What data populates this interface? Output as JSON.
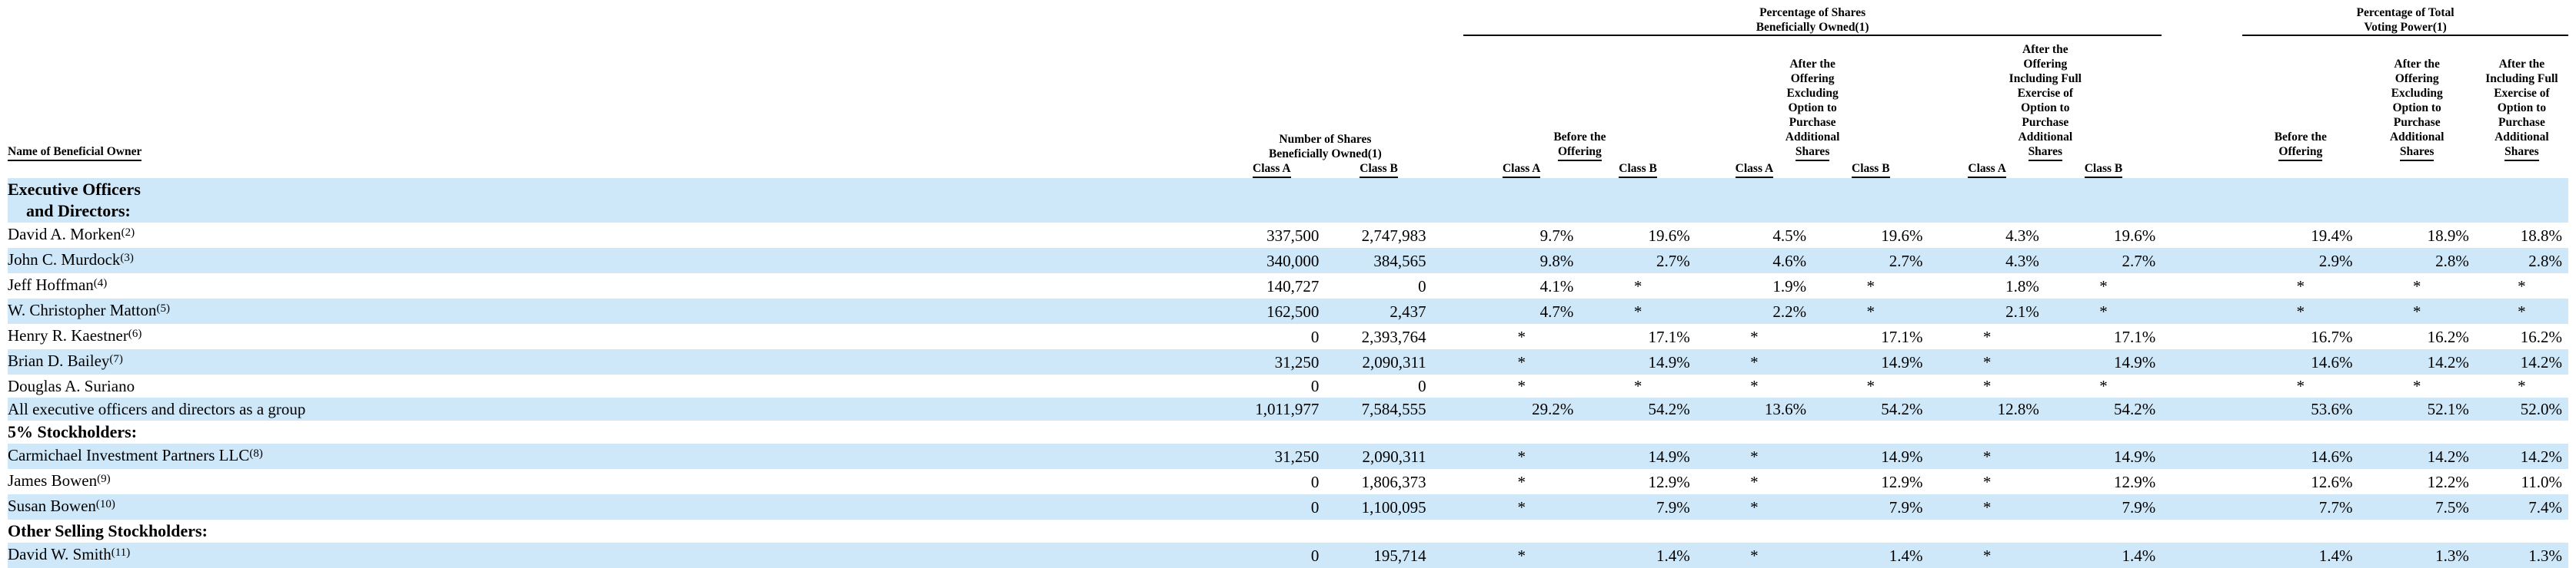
{
  "header": {
    "owner_col": "Name of Beneficial Owner",
    "shares_group": [
      "Number of Shares",
      "Beneficially Owned(1)"
    ],
    "pct_shares_group": [
      "Percentage of Shares",
      "Beneficially Owned(1)"
    ],
    "pct_voting_group": [
      "Percentage of Total",
      "Voting Power(1)"
    ],
    "before_offering": [
      "Before the",
      "Offering"
    ],
    "after_excl": [
      "After the",
      "Offering",
      "Excluding",
      "Option to",
      "Purchase",
      "Additional",
      "Shares"
    ],
    "after_incl": [
      "After the",
      "Offering",
      "Including Full",
      "Exercise of",
      "Option to",
      "Purchase",
      "Additional",
      "Shares"
    ],
    "class_a": "Class A",
    "class_b": "Class B"
  },
  "rows": [
    {
      "type": "section",
      "label": "Executive Officers",
      "label2": "and Directors:",
      "shaded": true
    },
    {
      "type": "data",
      "name": "David A. Morken",
      "note": "(2)",
      "shaded": false,
      "values": [
        "337,500",
        "2,747,983",
        "9.7%",
        "19.6%",
        "4.5%",
        "19.6%",
        "4.3%",
        "19.6%",
        "19.4%",
        "18.9%",
        "18.8%"
      ]
    },
    {
      "type": "data",
      "name": "John C. Murdock",
      "note": "(3)",
      "shaded": true,
      "values": [
        "340,000",
        "384,565",
        "9.8%",
        "2.7%",
        "4.6%",
        "2.7%",
        "4.3%",
        "2.7%",
        "2.9%",
        "2.8%",
        "2.8%"
      ]
    },
    {
      "type": "data",
      "name": "Jeff Hoffman",
      "note": "(4)",
      "shaded": false,
      "values": [
        "140,727",
        "0",
        "4.1%",
        "*",
        "1.9%",
        "*",
        "1.8%",
        "*",
        "*",
        "*",
        "*"
      ]
    },
    {
      "type": "data",
      "name": "W. Christopher Matton",
      "note": "(5)",
      "shaded": true,
      "values": [
        "162,500",
        "2,437",
        "4.7%",
        "*",
        "2.2%",
        "*",
        "2.1%",
        "*",
        "*",
        "*",
        "*"
      ]
    },
    {
      "type": "data",
      "name": "Henry R. Kaestner",
      "note": "(6)",
      "shaded": false,
      "values": [
        "0",
        "2,393,764",
        "*",
        "17.1%",
        "*",
        "17.1%",
        "*",
        "17.1%",
        "16.7%",
        "16.2%",
        "16.2%"
      ]
    },
    {
      "type": "data",
      "name": "Brian D. Bailey",
      "note": "(7)",
      "shaded": true,
      "values": [
        "31,250",
        "2,090,311",
        "*",
        "14.9%",
        "*",
        "14.9%",
        "*",
        "14.9%",
        "14.6%",
        "14.2%",
        "14.2%"
      ]
    },
    {
      "type": "data",
      "name": "Douglas A. Suriano",
      "note": "",
      "shaded": false,
      "values": [
        "0",
        "0",
        "*",
        "*",
        "*",
        "*",
        "*",
        "*",
        "*",
        "*",
        "*"
      ]
    },
    {
      "type": "data",
      "name": "All executive officers and directors as a group",
      "note": "",
      "shaded": true,
      "values": [
        "1,011,977",
        "7,584,555",
        "29.2%",
        "54.2%",
        "13.6%",
        "54.2%",
        "12.8%",
        "54.2%",
        "53.6%",
        "52.1%",
        "52.0%"
      ]
    },
    {
      "type": "section",
      "label": "5% Stockholders:",
      "shaded": false
    },
    {
      "type": "data",
      "name": "Carmichael Investment Partners LLC",
      "note": "(8)",
      "shaded": true,
      "values": [
        "31,250",
        "2,090,311",
        "*",
        "14.9%",
        "*",
        "14.9%",
        "*",
        "14.9%",
        "14.6%",
        "14.2%",
        "14.2%"
      ]
    },
    {
      "type": "data",
      "name": "James Bowen",
      "note": "(9)",
      "shaded": false,
      "values": [
        "0",
        "1,806,373",
        "*",
        "12.9%",
        "*",
        "12.9%",
        "*",
        "12.9%",
        "12.6%",
        "12.2%",
        "11.0%"
      ]
    },
    {
      "type": "data",
      "name": "Susan Bowen",
      "note": "(10)",
      "shaded": true,
      "values": [
        "0",
        "1,100,095",
        "*",
        "7.9%",
        "*",
        "7.9%",
        "*",
        "7.9%",
        "7.7%",
        "7.5%",
        "7.4%"
      ]
    },
    {
      "type": "section",
      "label": "Other Selling Stockholders:",
      "shaded": false
    },
    {
      "type": "data",
      "name": "David W. Smith",
      "note": "(11)",
      "shaded": true,
      "values": [
        "0",
        "195,714",
        "*",
        "1.4%",
        "*",
        "1.4%",
        "*",
        "1.4%",
        "1.4%",
        "1.3%",
        "1.3%"
      ]
    }
  ],
  "colors": {
    "row_shade": "#cfe8f9",
    "text": "#000000"
  }
}
